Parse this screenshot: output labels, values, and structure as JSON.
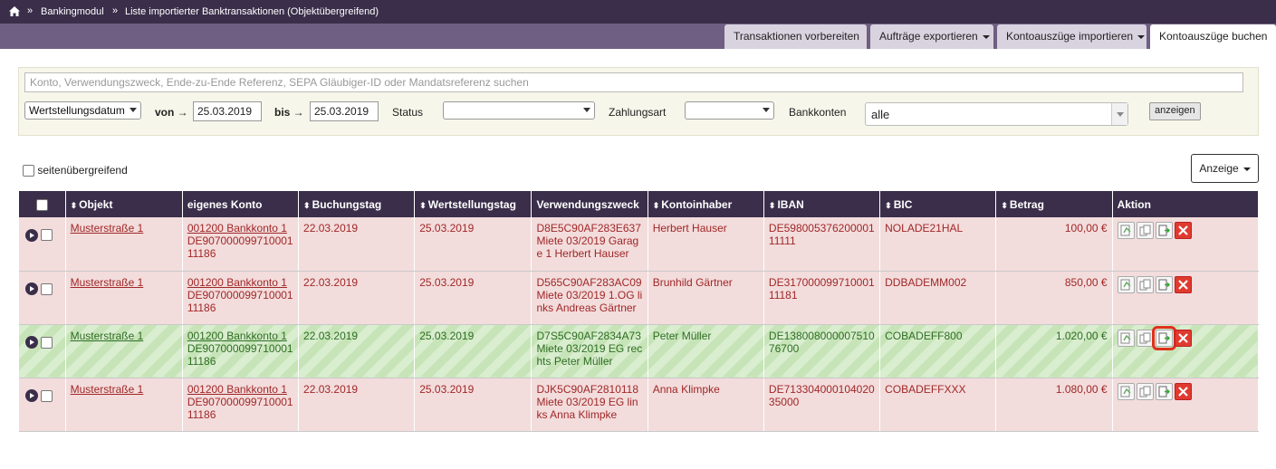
{
  "breadcrumb": {
    "home_icon": "home-icon",
    "sep": "»",
    "items": [
      "Bankingmodul",
      "Liste importierter Banktransaktionen (Objektübergreifend)"
    ]
  },
  "tabs": [
    {
      "label": "Transaktionen vorbereiten",
      "dropdown": false
    },
    {
      "label": "Aufträge exportieren",
      "dropdown": true
    },
    {
      "label": "Kontoauszüge importieren",
      "dropdown": true
    },
    {
      "label": "Kontoauszüge buchen",
      "dropdown": false,
      "active": true
    }
  ],
  "filter": {
    "search_placeholder": "Konto, Verwendungszweck, Ende-zu-Ende Referenz, SEPA Gläubiger-ID oder Mandatsreferenz suchen",
    "date_type": "Wertstellungsdatum",
    "von_label": "von →",
    "von_value": "25.03.2019",
    "bis_label": "bis →",
    "bis_value": "25.03.2019",
    "status_label": "Status",
    "status_value": "",
    "zahlungsart_label": "Zahlungsart",
    "zahlungsart_value": "",
    "bankkonten_label": "Bankkonten",
    "bankkonten_value": "alle",
    "show_button": "anzeigen"
  },
  "cross_page_label": "seitenübergreifend",
  "anzeige_button": "Anzeige",
  "table": {
    "columns": [
      "Objekt",
      "eigenes Konto",
      "Buchungstag",
      "Wertstellungstag",
      "Verwendungszweck",
      "Kontoinhaber",
      "IBAN",
      "BIC",
      "Betrag",
      "Aktion"
    ],
    "rows": [
      {
        "status": "red",
        "objekt": "Musterstraße 1",
        "konto_name": "001200 Bankkonto 1",
        "konto_iban": "DE90700009971000111186",
        "buchungstag": "22.03.2019",
        "wertstellungstag": "25.03.2019",
        "verwendungszweck": "D8E5C90AF283E637 Miete 03/2019 Garage 1 Herbert Hauser",
        "kontoinhaber": "Herbert Hauser",
        "iban": "DE59800537620000111111",
        "bic": "NOLADE21HAL",
        "betrag": "100,00 €"
      },
      {
        "status": "red",
        "objekt": "Musterstraße 1",
        "konto_name": "001200 Bankkonto 1",
        "konto_iban": "DE90700009971000111186",
        "buchungstag": "22.03.2019",
        "wertstellungstag": "25.03.2019",
        "verwendungszweck": "D565C90AF283AC09 Miete 03/2019 1.OG links Andreas Gärtner",
        "kontoinhaber": "Brunhild Gärtner",
        "iban": "DE31700009971000111181",
        "bic": "DDBADEMM002",
        "betrag": "850,00 €"
      },
      {
        "status": "green",
        "objekt": "Musterstraße 1",
        "konto_name": "001200 Bankkonto 1",
        "konto_iban": "DE90700009971000111186",
        "buchungstag": "22.03.2019",
        "wertstellungstag": "25.03.2019",
        "verwendungszweck": "D7S5C90AF2834A73 Miete 03/2019 EG rechts Peter Müller",
        "kontoinhaber": "Peter Müller",
        "iban": "DE13800800000751076700",
        "bic": "COBADEFF800",
        "betrag": "1.020,00 €"
      },
      {
        "status": "red",
        "objekt": "Musterstraße 1",
        "konto_name": "001200 Bankkonto 1",
        "konto_iban": "DE90700009971000111186",
        "buchungstag": "22.03.2019",
        "wertstellungstag": "25.03.2019",
        "verwendungszweck": "DJK5C90AF2810118 Miete 03/2019 EG links Anna Klimpke",
        "kontoinhaber": "Anna Klimpke",
        "iban": "DE71330400010402035000",
        "bic": "COBADEFFXXX",
        "betrag": "1.080,00 €"
      }
    ],
    "action_icons": [
      "book-icon",
      "split-icon",
      "assign-document-icon",
      "delete-icon"
    ],
    "highlighted_action": {
      "row": 2,
      "icon": "assign-document-icon"
    }
  },
  "colors": {
    "header": "#3a2e4a",
    "tabbar": "#6f5f82",
    "row_red": "#f3dcdc",
    "row_green": "#d9edcf",
    "text_red": "#a02828",
    "text_green": "#2e6e24",
    "highlight": "#e0301c"
  }
}
